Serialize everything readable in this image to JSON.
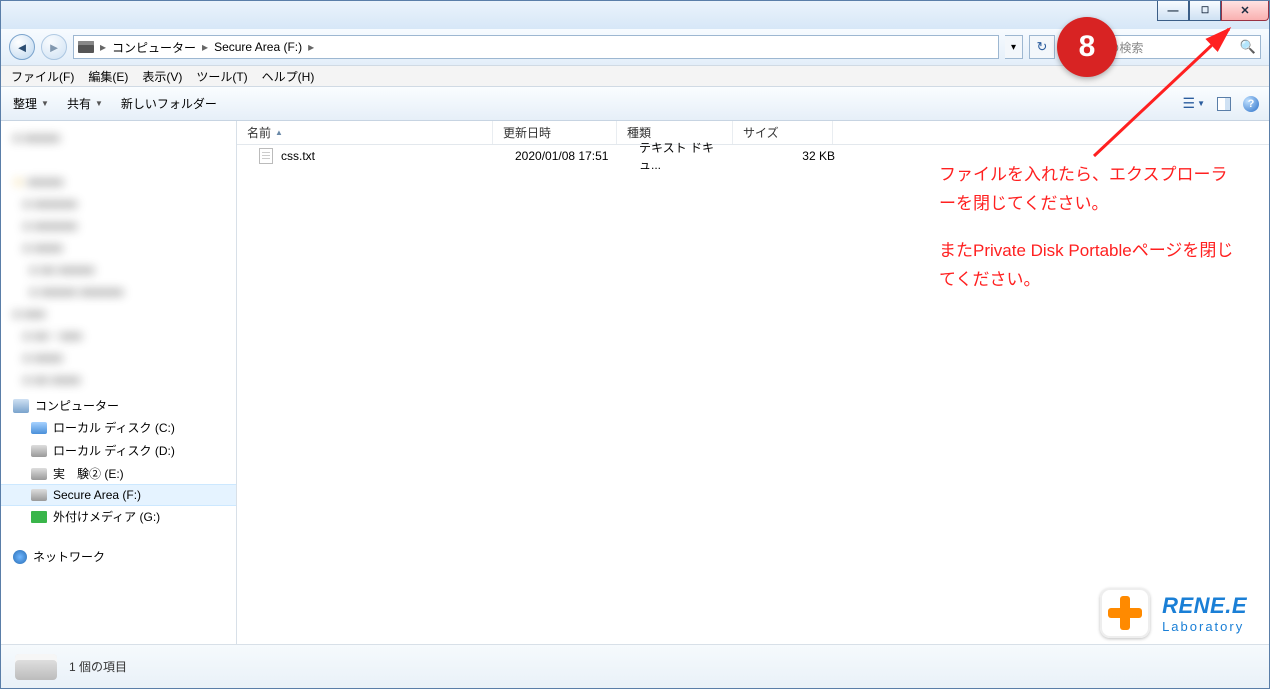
{
  "window_controls": {
    "minimize": "min",
    "maximize": "max",
    "close": "close"
  },
  "breadcrumb": {
    "root": "コンピューター",
    "current": "Secure Area (F:)"
  },
  "search": {
    "placeholder": "rea (F:)の検索"
  },
  "menubar": [
    "ファイル(F)",
    "編集(E)",
    "表示(V)",
    "ツール(T)",
    "ヘルプ(H)"
  ],
  "toolbar": {
    "organize": "整理",
    "share": "共有",
    "new_folder": "新しいフォルダー"
  },
  "columns": {
    "name": "名前",
    "date": "更新日時",
    "type": "種類",
    "size": "サイズ"
  },
  "files": [
    {
      "name": "css.txt",
      "date": "2020/01/08 17:51",
      "type": "テキスト ドキュ...",
      "size": "32 KB"
    }
  ],
  "sidebar": {
    "computer": "コンピューター",
    "drives": [
      {
        "label": "ローカル ディスク (C:)",
        "icon": "blue"
      },
      {
        "label": "ローカル ディスク (D:)",
        "icon": "gray"
      },
      {
        "label": "実　験② (E:)",
        "icon": "gray"
      },
      {
        "label": "Secure Area (F:)",
        "icon": "gray",
        "selected": true
      },
      {
        "label": "外付けメディア (G:)",
        "icon": "green"
      }
    ],
    "network": "ネットワーク"
  },
  "status": {
    "text": "1 個の項目"
  },
  "annotation": {
    "badge": "8",
    "line1": "ファイルを入れたら、エクスプローラーを閉じてください。",
    "line2": "またPrivate Disk Portableページを閉じてください。"
  },
  "logo": {
    "brand": "RENE.E",
    "sub": "Laboratory"
  }
}
